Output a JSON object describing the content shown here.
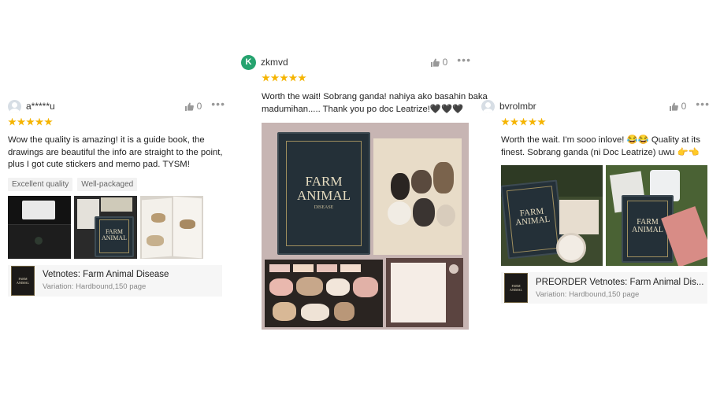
{
  "reviews": [
    {
      "avatar_icon": "user-placeholder-icon",
      "username": "a*****u",
      "likes": "0",
      "rating": 5,
      "text": "Wow the quality is amazing! it is a guide book, the drawings are beautiful the info are straight to the point, plus I got cute stickers and memo pad. TYSM!",
      "tags": [
        "Excellent quality",
        "Well-packaged"
      ],
      "product": {
        "name": "Vetnotes: Farm Animal Disease",
        "variation": "Variation: Hardbound,150 page"
      }
    },
    {
      "avatar_letter": "K",
      "username": "zkmvd",
      "likes": "0",
      "rating": 5,
      "text": "Worth the wait! Sobrang ganda! nahiya ako basahin baka madumihan..... Thank you po doc Leatrize!🖤🖤🖤"
    },
    {
      "avatar_icon": "user-placeholder-icon",
      "username": "bvrolmbr",
      "likes": "0",
      "rating": 5,
      "text": "Worth the wait. I'm sooo inlove! 😂😂 Quality at its finest. Sobrang ganda (ni Doc Leatrize) uwu 👉👈",
      "product": {
        "name": "PREORDER Vetnotes: Farm Animal Dis...",
        "variation": "Variation: Hardbound,150 page"
      }
    }
  ],
  "book": {
    "title_line1": "FARM",
    "title_line2": "ANIMAL",
    "subtitle": "DISEASE"
  },
  "colors": {
    "star": "#f5b400",
    "avatar_k": "#25a36f",
    "tag_bg": "#f2f2f2"
  }
}
